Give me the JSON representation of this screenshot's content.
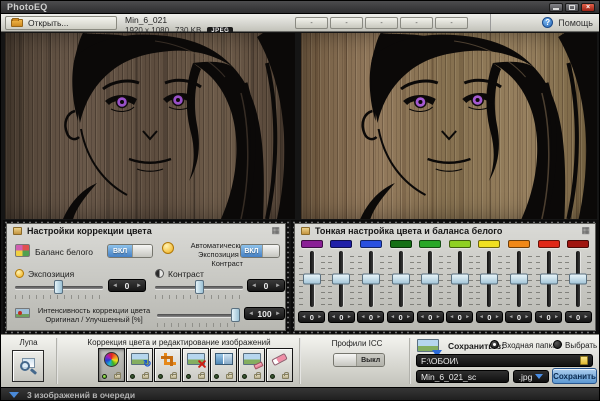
{
  "window": {
    "title": "PhotoEQ"
  },
  "icons": {
    "close": "×",
    "help": "?",
    "panel_grid": "▦",
    "rotate": "↻"
  },
  "ui": {
    "spin_prev": "◄",
    "spin_next": "►"
  },
  "toolbar": {
    "open_label": "Открыть...",
    "file_name": "Min_6_021",
    "file_dims": "1920 x 1080",
    "file_size": "730 KB",
    "file_format_badge": "JPEG",
    "preset_buttons": [
      "-",
      "-",
      "-",
      "-",
      "-"
    ],
    "help_label": "Помощь"
  },
  "left_panel": {
    "title": "Настройки коррекции цвета",
    "white_balance_label": "Баланс белого",
    "white_balance_state": "ВКЛ",
    "auto_label_line1": "Автоматически",
    "auto_label_line2": "Экспозиция / Контраст",
    "auto_state": "ВКЛ",
    "exposure_label": "Экспозиция",
    "exposure_value": "0",
    "contrast_label": "Контраст",
    "contrast_value": "0",
    "intensity_label_line1": "Интенсивность коррекции цвета",
    "intensity_label_line2": "Оригинал / Улучшенный [%]",
    "intensity_value": "100"
  },
  "right_panel": {
    "title": "Тонкая настройка цвета и баланса белого",
    "channels": [
      {
        "color": "#8a1f96",
        "value": "0"
      },
      {
        "color": "#1f1fa8",
        "value": "0"
      },
      {
        "color": "#2a50e0",
        "value": "0"
      },
      {
        "color": "#157015",
        "value": "0"
      },
      {
        "color": "#28a828",
        "value": "0"
      },
      {
        "color": "#8fd022",
        "value": "0"
      },
      {
        "color": "#f0e020",
        "value": "0"
      },
      {
        "color": "#f08818",
        "value": "0"
      },
      {
        "color": "#e02818",
        "value": "0"
      },
      {
        "color": "#a01510",
        "value": "0"
      }
    ]
  },
  "bottom_toolbar": {
    "magnifier_label": "Лупа",
    "tools_label": "Коррекция цвета и редактирование изображений",
    "tools": [
      {
        "icon": "color-wheel-icon"
      },
      {
        "icon": "rotate-image-icon"
      },
      {
        "icon": "crop-icon"
      },
      {
        "icon": "cut-image-icon"
      },
      {
        "icon": "split-compare-icon"
      },
      {
        "icon": "retouch-eraser-icon"
      },
      {
        "icon": "eraser-icon"
      }
    ],
    "icc_label": "Профили ICC",
    "icc_state": "Выкл",
    "save": {
      "save_to_label": "Сохранить в:",
      "radio_input_folder": "Входная папка",
      "radio_choose": "Выбрать",
      "path": "F:\\ОБОИ\\",
      "filename": "Min_6_021_sc",
      "format": ".jpg",
      "save_button": "Сохранить"
    }
  },
  "statusbar": {
    "queue_text": "3 изображений в очереди"
  }
}
